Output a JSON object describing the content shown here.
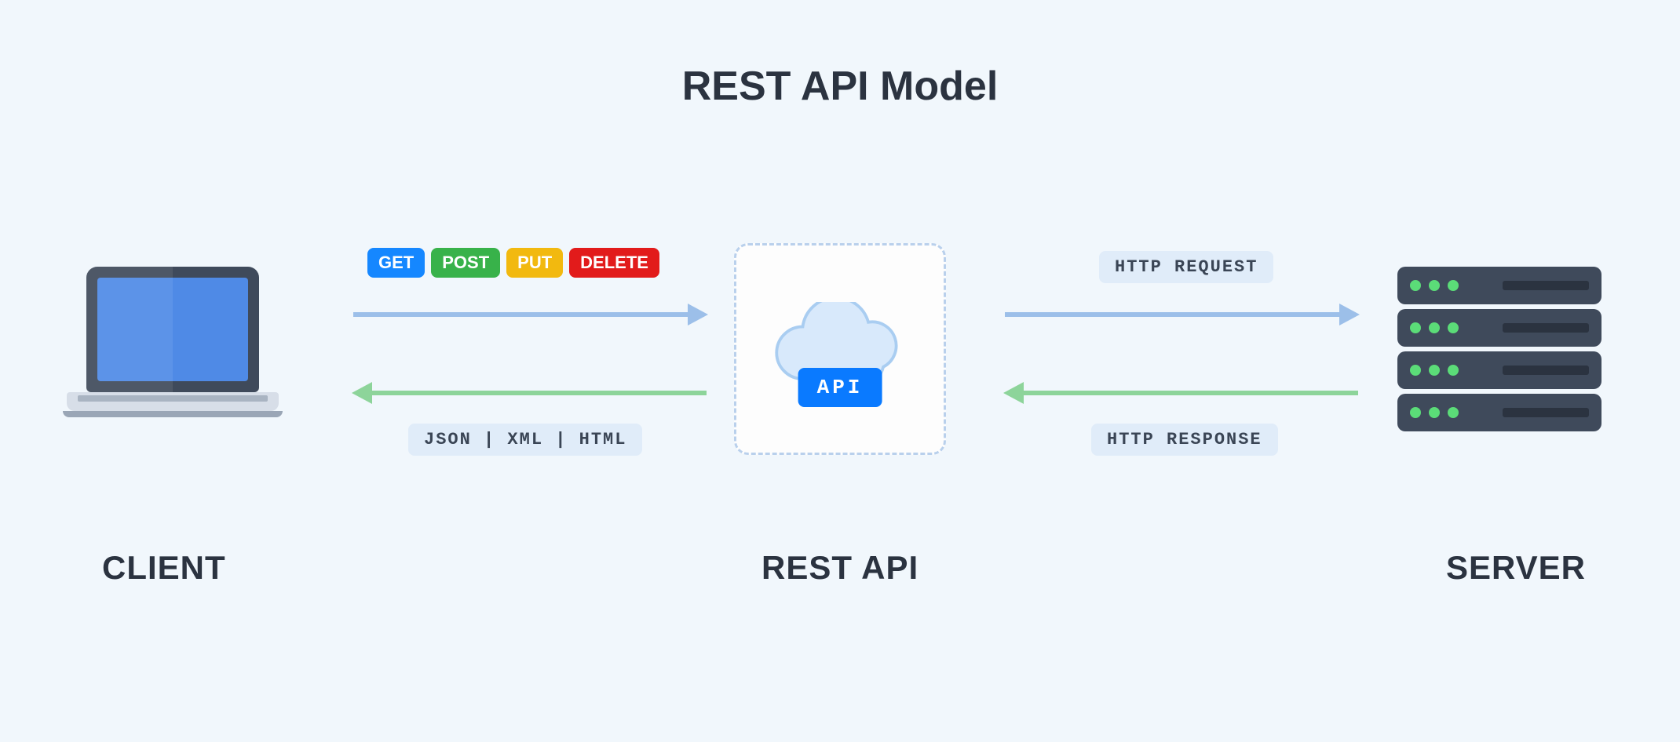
{
  "title": "REST API Model",
  "nodes": {
    "client": "CLIENT",
    "api": "REST API",
    "server": "SERVER"
  },
  "api_badge": "API",
  "http_methods": [
    {
      "label": "GET",
      "color": "#1587ff"
    },
    {
      "label": "POST",
      "color": "#38b24a"
    },
    {
      "label": "PUT",
      "color": "#f2b90f"
    },
    {
      "label": "DELETE",
      "color": "#e21b1b"
    }
  ],
  "response_formats": "JSON | XML | HTML",
  "flows": {
    "request": "HTTP REQUEST",
    "response": "HTTP RESPONSE"
  },
  "colors": {
    "arrow_request": "#9cbfe9",
    "arrow_response": "#8dd49a",
    "text_dark": "#2b3340",
    "bg": "#f1f7fc",
    "api_blue": "#0a7aff"
  }
}
